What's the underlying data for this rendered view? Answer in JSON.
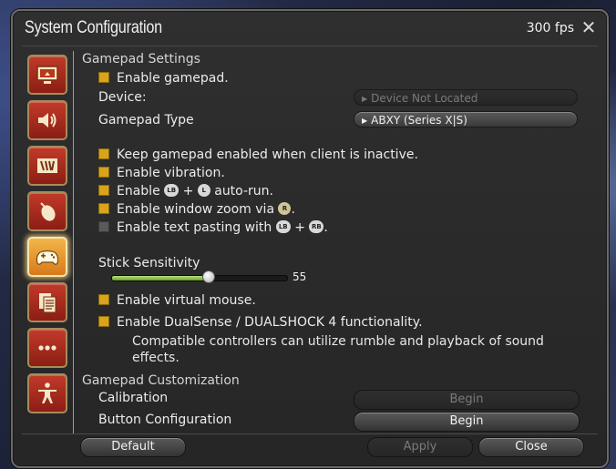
{
  "window": {
    "title": "System Configuration",
    "fps": "300 fps"
  },
  "sidebar": {
    "items": [
      {
        "name": "display-settings",
        "icon": "monitor-icon"
      },
      {
        "name": "sound-settings",
        "icon": "speaker-icon"
      },
      {
        "name": "other-settings",
        "icon": "card-icon"
      },
      {
        "name": "mouse-settings",
        "icon": "mouse-icon"
      },
      {
        "name": "gamepad-settings",
        "icon": "gamepad-icon",
        "active": true
      },
      {
        "name": "system-info",
        "icon": "document-icon"
      },
      {
        "name": "other",
        "icon": "ellipsis-icon"
      },
      {
        "name": "accessibility",
        "icon": "figure-icon"
      }
    ]
  },
  "gamepad": {
    "section_title": "Gamepad Settings",
    "enable_label": "Enable gamepad.",
    "enable_checked": true,
    "device_label": "Device:",
    "device_value": "Device Not Located",
    "type_label": "Gamepad Type",
    "type_value": "ABXY (Series X|S)",
    "keep_enabled_label": "Keep gamepad enabled when client is inactive.",
    "keep_enabled_checked": true,
    "vibration_label": "Enable vibration.",
    "vibration_checked": true,
    "autorun_prefix": "Enable",
    "autorun_suffix": "auto-run.",
    "autorun_checked": true,
    "zoom_prefix": "Enable window zoom via",
    "zoom_suffix": ".",
    "zoom_checked": true,
    "paste_prefix": "Enable text pasting with",
    "paste_suffix": ".",
    "paste_checked": false,
    "glyph_lb": "LB",
    "glyph_l": "L",
    "glyph_r": "R",
    "glyph_rb": "RB",
    "plus": "+",
    "sensitivity_label": "Stick Sensitivity",
    "sensitivity_value": 55,
    "sensitivity_max": 100,
    "virtual_mouse_label": "Enable virtual mouse.",
    "virtual_mouse_checked": true,
    "dualsense_label": "Enable DualSense / DUALSHOCK 4 functionality.",
    "dualsense_checked": true,
    "dualsense_note": "Compatible controllers can utilize rumble and playback of sound effects."
  },
  "customization": {
    "section_title": "Gamepad Customization",
    "calibration_label": "Calibration",
    "calibration_button": "Begin",
    "button_config_label": "Button Configuration",
    "button_config_button": "Begin"
  },
  "footer": {
    "default_label": "Default",
    "apply_label": "Apply",
    "close_label": "Close"
  },
  "colors": {
    "checkbox": "#d9a41a",
    "slider": "#8cc63f",
    "accent": "#c79a3a",
    "sidebar_button": "#b22d20"
  }
}
